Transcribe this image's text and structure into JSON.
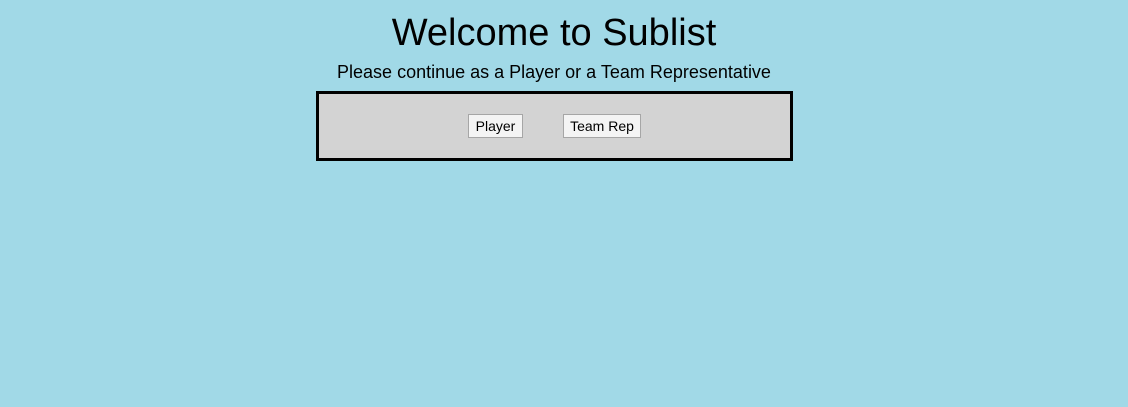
{
  "page": {
    "title": "Welcome to Sublist",
    "subtitle": "Please continue as a Player or a Team Representative"
  },
  "choices": {
    "player_label": "Player",
    "team_rep_label": "Team Rep"
  },
  "colors": {
    "background": "#a1d9e7",
    "panel": "#d3d3d3",
    "panel_border": "#000000"
  }
}
